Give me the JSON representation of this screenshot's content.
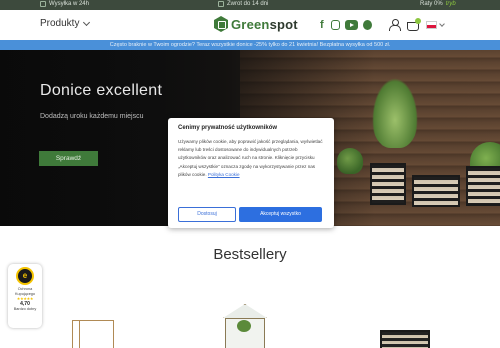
{
  "topbar": {
    "shipping": "Wysyłka w 24h",
    "returns": "Zwrot do 14 dni",
    "installments_prefix": "Raty 0%",
    "installments_brand": "tryb"
  },
  "header": {
    "products_label": "Produkty",
    "logo_text_prefix": "Green",
    "logo_text_suffix": "spot",
    "social_icons": [
      "facebook-icon",
      "instagram-icon",
      "youtube-icon",
      "pinterest-icon"
    ],
    "language": "PL"
  },
  "promo": {
    "text": "Często braknie w Twoim ogrodzie? Teraz wszystkie donice -25% tylko do 21 kwietnia! Bezpłatna wysyłka od 500 zł."
  },
  "hero": {
    "title": "Donice excellent",
    "subtitle": "Dodadzą uroku każdemu miejscu",
    "cta_label": "Sprawdź"
  },
  "bestsellers": {
    "title": "Bestsellery"
  },
  "trust_badge": {
    "logo_letter": "e",
    "label_line1": "Ochrona",
    "label_line2": "Kupującego",
    "stars": "★★★★★",
    "score": "4,70",
    "rating_word": "Bardzo dobry"
  },
  "cookie_modal": {
    "title": "Cenimy prywatność użytkowników",
    "body": "Używamy plików cookie, aby poprawić jakość przeglądania, wyświetlać reklamy lub treści dostosowane do indywidualnych potrzeb użytkowników oraz analizować ruch na stronie. Kliknięcie przycisku „Akceptuj wszystkie” oznacza zgodę na wykorzystywanie przez nas plików cookie.",
    "policy_link": "Polityka Cookie",
    "configure_label": "Dostosuj",
    "accept_label": "Akceptuj wszystko"
  },
  "colors": {
    "brand_green": "#3f7a3a",
    "promo_blue": "#4a90d9",
    "accept_blue": "#2d6fe0"
  }
}
